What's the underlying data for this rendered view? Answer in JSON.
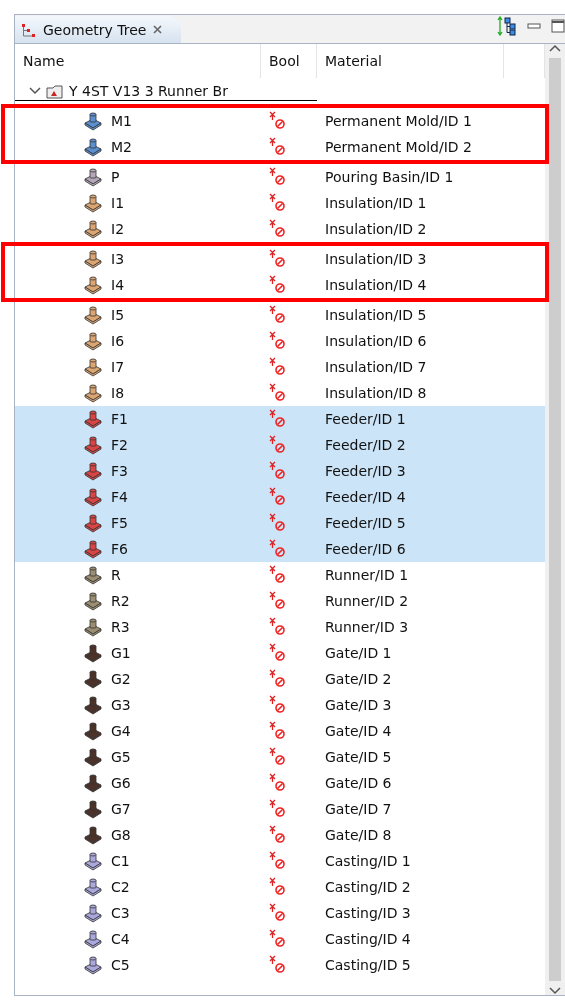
{
  "view": {
    "tab": {
      "title": "Geometry Tree",
      "selected": true
    }
  },
  "tree": {
    "columns": [
      "Name",
      "Bool",
      "Material"
    ],
    "root": {
      "name": "Y 4ST V13 3 Runner Br",
      "expanded": true,
      "children": [
        {
          "name": "M1",
          "material": "Permanent Mold/ID 1",
          "color": "#5b8fcf",
          "selected": false,
          "boxed": true
        },
        {
          "name": "M2",
          "material": "Permanent Mold/ID 2",
          "color": "#5b8fcf",
          "selected": false,
          "boxed": true
        },
        {
          "name": "P",
          "material": "Pouring Basin/ID 1",
          "color": "#b4a8b8",
          "selected": false,
          "boxed": false
        },
        {
          "name": "I1",
          "material": "Insulation/ID 1",
          "color": "#dca672",
          "selected": false,
          "boxed": false
        },
        {
          "name": "I2",
          "material": "Insulation/ID 2",
          "color": "#dca672",
          "selected": false,
          "boxed": false
        },
        {
          "name": "I3",
          "material": "Insulation/ID 3",
          "color": "#dca672",
          "selected": false,
          "boxed": true
        },
        {
          "name": "I4",
          "material": "Insulation/ID 4",
          "color": "#dca672",
          "selected": false,
          "boxed": true
        },
        {
          "name": "I5",
          "material": "Insulation/ID 5",
          "color": "#dca672",
          "selected": false,
          "boxed": false
        },
        {
          "name": "I6",
          "material": "Insulation/ID 6",
          "color": "#dca672",
          "selected": false,
          "boxed": false
        },
        {
          "name": "I7",
          "material": "Insulation/ID 7",
          "color": "#dca672",
          "selected": false,
          "boxed": false
        },
        {
          "name": "I8",
          "material": "Insulation/ID 8",
          "color": "#dca672",
          "selected": false,
          "boxed": false
        },
        {
          "name": "F1",
          "material": "Feeder/ID 1",
          "color": "#d94444",
          "selected": true,
          "boxed": false
        },
        {
          "name": "F2",
          "material": "Feeder/ID 2",
          "color": "#d94444",
          "selected": true,
          "boxed": false
        },
        {
          "name": "F3",
          "material": "Feeder/ID 3",
          "color": "#d94444",
          "selected": true,
          "boxed": false
        },
        {
          "name": "F4",
          "material": "Feeder/ID 4",
          "color": "#d94444",
          "selected": true,
          "boxed": false
        },
        {
          "name": "F5",
          "material": "Feeder/ID 5",
          "color": "#d94444",
          "selected": true,
          "boxed": false
        },
        {
          "name": "F6",
          "material": "Feeder/ID 6",
          "color": "#d94444",
          "selected": true,
          "boxed": false
        },
        {
          "name": "R",
          "material": "Runner/ID 1",
          "color": "#9c8e72",
          "selected": false,
          "boxed": false
        },
        {
          "name": "R2",
          "material": "Runner/ID 2",
          "color": "#9c8e72",
          "selected": false,
          "boxed": false
        },
        {
          "name": "R3",
          "material": "Runner/ID 3",
          "color": "#9c8e72",
          "selected": false,
          "boxed": false
        },
        {
          "name": "G1",
          "material": "Gate/ID 1",
          "color": "#4e3228",
          "selected": false,
          "boxed": false
        },
        {
          "name": "G2",
          "material": "Gate/ID 2",
          "color": "#4e3228",
          "selected": false,
          "boxed": false
        },
        {
          "name": "G3",
          "material": "Gate/ID 3",
          "color": "#4e3228",
          "selected": false,
          "boxed": false
        },
        {
          "name": "G4",
          "material": "Gate/ID 4",
          "color": "#4e3228",
          "selected": false,
          "boxed": false
        },
        {
          "name": "G5",
          "material": "Gate/ID 5",
          "color": "#4e3228",
          "selected": false,
          "boxed": false
        },
        {
          "name": "G6",
          "material": "Gate/ID 6",
          "color": "#4e3228",
          "selected": false,
          "boxed": false
        },
        {
          "name": "G7",
          "material": "Gate/ID 7",
          "color": "#4e3228",
          "selected": false,
          "boxed": false
        },
        {
          "name": "G8",
          "material": "Gate/ID 8",
          "color": "#4e3228",
          "selected": false,
          "boxed": false
        },
        {
          "name": "C1",
          "material": "Casting/ID 1",
          "color": "#aaa8dc",
          "selected": false,
          "boxed": false
        },
        {
          "name": "C2",
          "material": "Casting/ID 2",
          "color": "#aaa8dc",
          "selected": false,
          "boxed": false
        },
        {
          "name": "C3",
          "material": "Casting/ID 3",
          "color": "#aaa8dc",
          "selected": false,
          "boxed": false
        },
        {
          "name": "C4",
          "material": "Casting/ID 4",
          "color": "#aaa8dc",
          "selected": false,
          "boxed": false
        },
        {
          "name": "C5",
          "material": "Casting/ID 5",
          "color": "#aaa8dc",
          "selected": false,
          "boxed": false
        }
      ]
    }
  }
}
